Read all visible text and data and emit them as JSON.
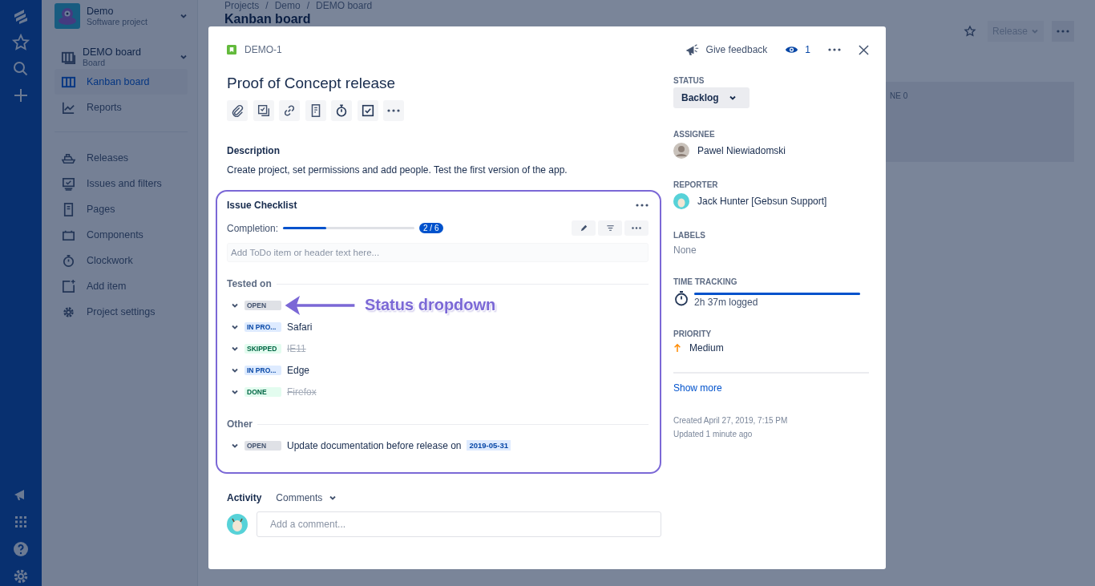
{
  "project": {
    "name": "Demo",
    "type": "Software project"
  },
  "board": {
    "name": "DEMO board",
    "type": "Board"
  },
  "sidebar": {
    "items": [
      {
        "label": "Kanban board",
        "selected": true
      },
      {
        "label": "Reports",
        "selected": false
      }
    ],
    "more_items": [
      {
        "label": "Releases",
        "selected": false
      },
      {
        "label": "Issues and filters",
        "selected": false
      },
      {
        "label": "Pages",
        "selected": false
      },
      {
        "label": "Components",
        "selected": false
      },
      {
        "label": "Clockwork",
        "selected": false
      },
      {
        "label": "Add item",
        "selected": false
      },
      {
        "label": "Project settings",
        "selected": false
      }
    ]
  },
  "breadcrumbs": {
    "separator": "/",
    "items": [
      "Projects",
      "Demo",
      "DEMO board"
    ]
  },
  "page_title": "Kanban board",
  "release_button": "Release",
  "board_column": "NE 0",
  "issue": {
    "key": "DEMO-1",
    "title": "Proof of Concept release",
    "description_heading": "Description",
    "description": "Create project, set permissions and add people. Test the first version of the app.",
    "checklist": {
      "title": "Issue Checklist",
      "completion_label": "Completion:",
      "level": 0.33,
      "count": "2 / 6",
      "placeholder": "Add ToDo item or header text here...",
      "sections": [
        {
          "title": "Tested on",
          "items": [
            {
              "status": "OPEN",
              "kind": "open"
            },
            {
              "status": "IN PRO...",
              "kind": "progress",
              "text": "Safari",
              "struck": false
            },
            {
              "status": "SKIPPED",
              "kind": "skipped",
              "text": "IE11",
              "struck": true
            },
            {
              "status": "IN PRO...",
              "kind": "progress",
              "text": "Edge",
              "struck": false
            },
            {
              "status": "DONE",
              "kind": "done",
              "text": "Firefox",
              "struck": true
            }
          ]
        },
        {
          "title": "Other",
          "items": [
            {
              "status": "OPEN",
              "kind": "open",
              "text": "Update documentation before release on",
              "date": "2019-05-31",
              "struck": false
            }
          ]
        }
      ]
    },
    "annotation": "Status dropdown",
    "activity": {
      "label": "Activity",
      "filter": "Comments",
      "placeholder": "Add a comment..."
    },
    "feedback": "Give feedback",
    "watchers": "1",
    "status": {
      "label": "STATUS",
      "value": "Backlog"
    },
    "assignee": {
      "label": "ASSIGNEE",
      "name": "Pawel Niewiadomski"
    },
    "reporter": {
      "label": "REPORTER",
      "name": "Jack Hunter [Gebsun Support]"
    },
    "labels": {
      "label": "LABELS",
      "value": "None"
    },
    "time_tracking": {
      "label": "TIME TRACKING",
      "logged": "2h 37m logged",
      "level": 1
    },
    "priority": {
      "label": "PRIORITY",
      "value": "Medium"
    },
    "show_more": "Show more",
    "created": "Created April 27, 2019, 7:15 PM",
    "updated": "Updated 1 minute ago"
  }
}
